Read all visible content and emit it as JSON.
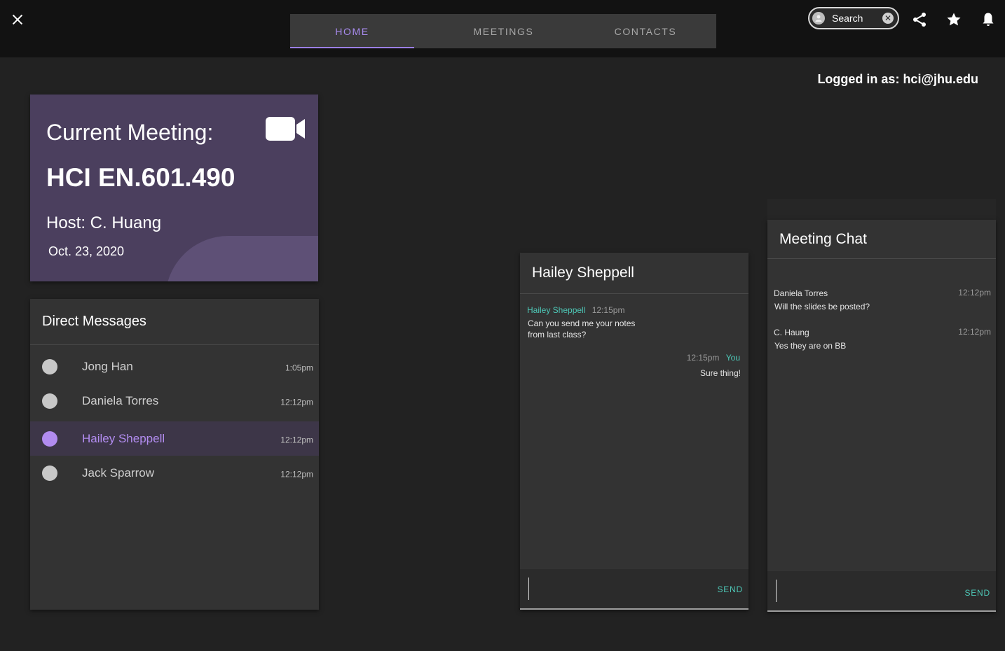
{
  "colors": {
    "accent": "#9b7fe6",
    "teal": "#4ec9b8",
    "meeting_bg": "#4b3f5e",
    "panel": "#333333"
  },
  "tabs": [
    {
      "label": "HOME",
      "active": true
    },
    {
      "label": "MEETINGS",
      "active": false
    },
    {
      "label": "CONTACTS",
      "active": false
    }
  ],
  "search": {
    "label": "Search"
  },
  "icons": {
    "close": "close-icon",
    "share": "share-icon",
    "star": "star-icon",
    "bell": "bell-icon",
    "video": "video-camera-icon"
  },
  "user": {
    "logged_in": "Logged in as: hci@jhu.edu"
  },
  "meeting": {
    "title": "Current Meeting:",
    "course": "HCI EN.601.490",
    "host": "Host: C. Huang",
    "date": "Oct. 23, 2020"
  },
  "dm": {
    "title": "Direct Messages",
    "items": [
      {
        "name": "Jong Han",
        "time": "1:05pm"
      },
      {
        "name": "Daniela Torres",
        "time": "12:12pm"
      },
      {
        "name": "Hailey Sheppell",
        "time": "12:12pm",
        "selected": true
      },
      {
        "name": "Jack Sparrow",
        "time": "12:12pm"
      }
    ]
  },
  "dm_chat": {
    "title": "Hailey Sheppell",
    "messages": [
      {
        "sender": "Hailey Sheppell",
        "time": "12:15pm",
        "lines": [
          "Can you send me your notes",
          "from last class?"
        ]
      },
      {
        "sender": "You",
        "time": "12:15pm",
        "lines": [
          "Sure thing!"
        ]
      }
    ],
    "send": "SEND"
  },
  "meeting_chat": {
    "title": "Meeting Chat",
    "messages": [
      {
        "sender": "Daniela Torres",
        "time": "12:12pm",
        "text": "Will the slides be posted?"
      },
      {
        "sender": "C. Haung",
        "time": "12:12pm",
        "text": "Yes they are on BB"
      }
    ],
    "send": "SEND"
  }
}
